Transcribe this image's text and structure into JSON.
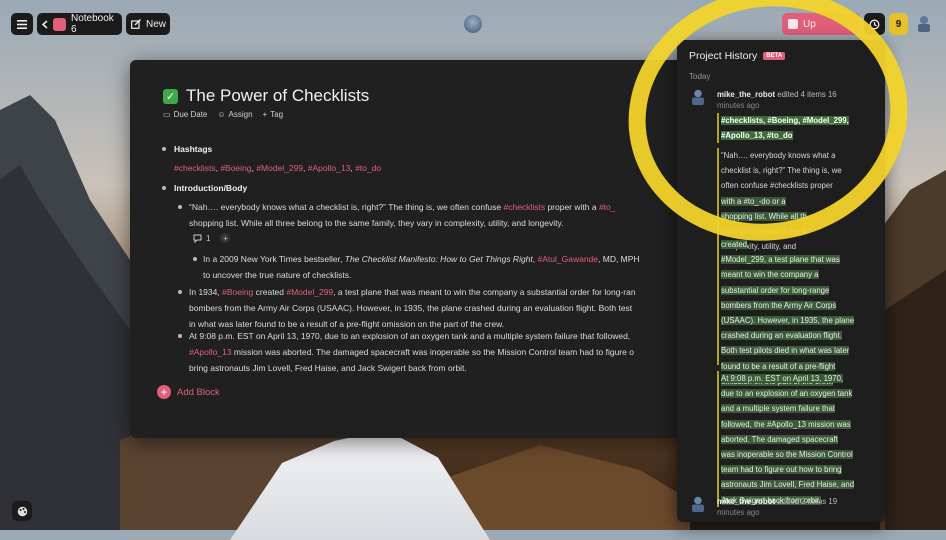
{
  "topbar": {
    "notebook_label": "Notebook 6",
    "new_label": "New",
    "upgrade_label": "Up",
    "count_badge": "9"
  },
  "doc": {
    "title": "The Power of Checklists",
    "meta": [
      "Due Date",
      "Assign",
      "Tag"
    ],
    "hashtags_heading": "Hashtags",
    "hashtags": [
      "#checklists",
      "#Boeing",
      "#Model_299",
      "#Apollo_13",
      "#to_do"
    ],
    "intro_heading": "Introduction/Body",
    "p1": {
      "a": "“Nah…. everybody knows what a checklist is, right?” The thing is, we often confuse ",
      "tag1": "#checklists",
      "b": " proper with a ",
      "tag2": "#to_",
      "c": "shopping list. While all three belong to the same family, they vary in complexity, utility, and longevity."
    },
    "comment_count": "1",
    "p2": {
      "a": "In a 2009 New York Times bestseller, ",
      "book": "The Checklist Manifesto: How to Get Things Right",
      "b": ", ",
      "tag": "#Atul_Gawande",
      "c": ", MD, MPH",
      "d": "to uncover the true nature of checklists."
    },
    "p3": {
      "a": "In 1934, ",
      "tag1": "#Boeing",
      "b": " created ",
      "tag2": "#Model_299",
      "c": ", a test plane that was meant to win the company a substantial order for long-ran",
      "d": "bombers from the Army Air Corps (USAAC). However, in 1935, the plane crashed during an evaluation flight. Both test",
      "e": "in what was later found to be a result of a pre-flight omission on the part of the crew."
    },
    "p4": {
      "a": "At 9:08 p.m. EST on April 13, 1970, due to an explosion of an oxygen tank and a multiple system failure that followed,",
      "tag": "#Apollo_13",
      "b": " mission was aborted. The damaged spacecraft was inoperable so the Mission Control team had to figure o",
      "c": "bring astronauts Jim Lovell, Fred Haise, and Jack Swigert back from orbit."
    },
    "add_block_label": "Add Block"
  },
  "history": {
    "title": "Project History",
    "beta": "BETA",
    "section": "Today",
    "entry1": {
      "user": "mike_the_robot",
      "action": " edited 4 items ",
      "time_a": "16",
      "time_b": "minutes ago"
    },
    "change1_lines": [
      "#checklists, #Boeing, #Model_299,",
      "#Apollo_13, #to_do"
    ],
    "change2_lines": [
      "“Nah…. everybody knows what a",
      "checklist is, right?” The thing is, we",
      "often confuse #checklists proper",
      "with a #to_-do or a",
      "shopping list. While all th",
      "belong to the same famil",
      "complexity, utility, and"
    ],
    "change3_lines": [
      "created",
      "#Model_299, a test plane that was",
      "meant to win the company a",
      "substantial order for long-range",
      "bombers from the Army Air Corps",
      "(USAAC). However, in 1935, the plane",
      "crashed during an evaluation flight.",
      "Both test pilots died in what was later",
      "found to be a result of a pre-flight",
      "omission on the part of the crew."
    ],
    "change4_lines": [
      "At 9:08 p.m. EST on April 13, 1970,",
      "due to an explosion of an oxygen tank",
      "and a multiple system failure that",
      "followed, the #Apollo_13 mission was",
      "aborted. The damaged spacecraft",
      "was inoperable so the Mission Control",
      "team had to figure out how to bring",
      "astronauts Jim Lovell, Fred Haise, and",
      "Jack Swigert back from orbit."
    ],
    "entry2": {
      "user": "mike_the_robot",
      "action": " added 2 items ",
      "time_a": "19",
      "time_b": "minutes ago"
    }
  },
  "colors": {
    "tag": "#e0607a",
    "accent_yellow": "#f2d32b",
    "change_green": "#3a5a38"
  }
}
